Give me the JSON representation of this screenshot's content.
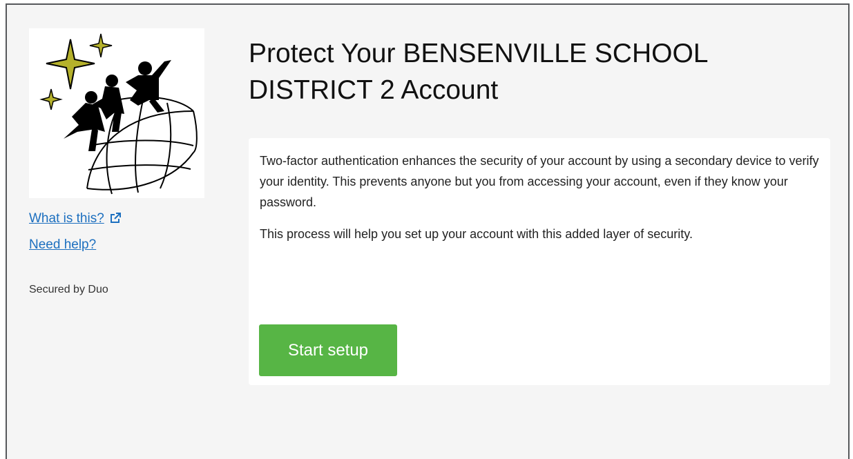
{
  "colors": {
    "link": "#1c6fbf",
    "button_bg": "#57b545",
    "panel_bg": "#f5f5f5",
    "star": "#b5b12b"
  },
  "sidebar": {
    "logo_icon": "children-globe-stars-logo",
    "what_is_this": "What is this?",
    "external_icon": "external-link-icon",
    "need_help": "Need help?",
    "secured_by": "Secured by Duo"
  },
  "main": {
    "title": "Protect Your BENSENVILLE SCHOOL DISTRICT 2 Account",
    "paragraph1": "Two-factor authentication enhances the security of your account by using a secondary device to verify your identity. This prevents anyone but you from accessing your account, even if they know your password.",
    "paragraph2": "This process will help you set up your account with this added layer of security.",
    "start_button": "Start setup"
  }
}
